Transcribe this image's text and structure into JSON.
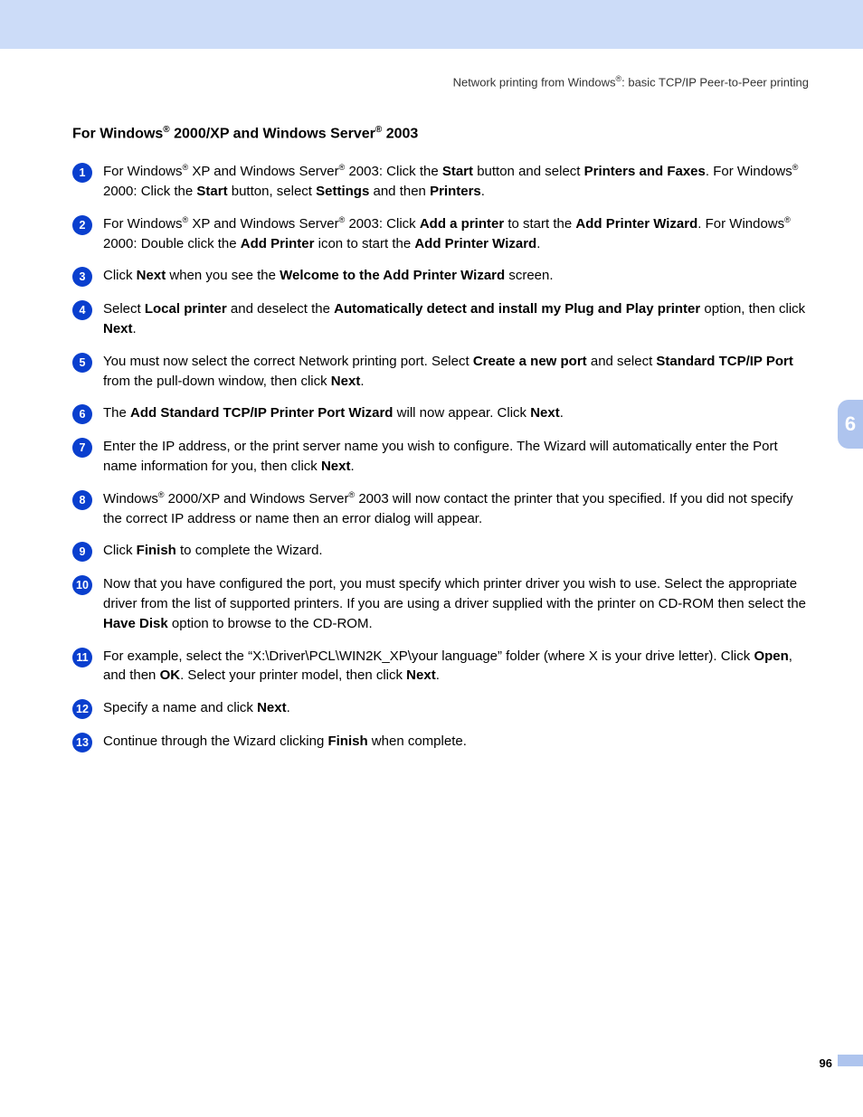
{
  "header": {
    "prefix": "Network printing from Windows",
    "suffix": ": basic TCP/IP Peer-to-Peer printing"
  },
  "heading": {
    "p1": "For Windows",
    "p2": " 2000/XP and Windows Server",
    "p3": " 2003"
  },
  "chapter_tab": "6",
  "page_number": "96",
  "steps": [
    {
      "num": "1",
      "segs": [
        {
          "t": "For Windows"
        },
        {
          "sup": "®"
        },
        {
          "t": " XP and Windows Server"
        },
        {
          "sup": "®"
        },
        {
          "t": " 2003: Click the "
        },
        {
          "b": "Start"
        },
        {
          "t": " button and select "
        },
        {
          "b": "Printers and Faxes"
        },
        {
          "t": ". For Windows"
        },
        {
          "sup": "®"
        },
        {
          "t": " 2000: Click the "
        },
        {
          "b": "Start"
        },
        {
          "t": " button, select "
        },
        {
          "b": "Settings"
        },
        {
          "t": " and then "
        },
        {
          "b": "Printers"
        },
        {
          "t": "."
        }
      ]
    },
    {
      "num": "2",
      "segs": [
        {
          "t": "For Windows"
        },
        {
          "sup": "®"
        },
        {
          "t": " XP and Windows Server"
        },
        {
          "sup": "®"
        },
        {
          "t": " 2003: Click "
        },
        {
          "b": "Add a printer"
        },
        {
          "t": " to start the "
        },
        {
          "b": "Add Printer Wizard"
        },
        {
          "t": ". For Windows"
        },
        {
          "sup": "®"
        },
        {
          "t": " 2000: Double click the "
        },
        {
          "b": "Add Printer"
        },
        {
          "t": " icon to start the "
        },
        {
          "b": "Add Printer Wizard"
        },
        {
          "t": "."
        }
      ]
    },
    {
      "num": "3",
      "segs": [
        {
          "t": "Click "
        },
        {
          "b": "Next"
        },
        {
          "t": " when you see the "
        },
        {
          "b": "Welcome to the Add Printer Wizard"
        },
        {
          "t": " screen."
        }
      ]
    },
    {
      "num": "4",
      "segs": [
        {
          "t": "Select "
        },
        {
          "b": "Local printer"
        },
        {
          "t": " and deselect the "
        },
        {
          "b": "Automatically detect and install my Plug and Play printer"
        },
        {
          "t": " option, then click "
        },
        {
          "b": "Next"
        },
        {
          "t": "."
        }
      ]
    },
    {
      "num": "5",
      "segs": [
        {
          "t": "You must now select the correct Network printing port. Select "
        },
        {
          "b": "Create a new port"
        },
        {
          "t": " and select "
        },
        {
          "b": "Standard TCP/IP Port"
        },
        {
          "t": " from the pull-down window, then click "
        },
        {
          "b": "Next"
        },
        {
          "t": "."
        }
      ]
    },
    {
      "num": "6",
      "segs": [
        {
          "t": "The "
        },
        {
          "b": "Add Standard TCP/IP Printer Port Wizard"
        },
        {
          "t": " will now appear. Click "
        },
        {
          "b": "Next"
        },
        {
          "t": "."
        }
      ]
    },
    {
      "num": "7",
      "segs": [
        {
          "t": "Enter the IP address, or the print server name you wish to configure. The Wizard will automatically enter the Port name information for you, then click "
        },
        {
          "b": "Next"
        },
        {
          "t": "."
        }
      ]
    },
    {
      "num": "8",
      "segs": [
        {
          "t": "Windows"
        },
        {
          "sup": "®"
        },
        {
          "t": " 2000/XP and Windows Server"
        },
        {
          "sup": "®"
        },
        {
          "t": " 2003 will now contact the printer that you specified. If you did not specify the correct IP address or name then an error dialog will appear."
        }
      ]
    },
    {
      "num": "9",
      "segs": [
        {
          "t": "Click "
        },
        {
          "b": "Finish"
        },
        {
          "t": " to complete the Wizard."
        }
      ]
    },
    {
      "num": "10",
      "segs": [
        {
          "t": "Now that you have configured the port, you must specify which printer driver you wish to use. Select the appropriate driver from the list of supported printers. If you are using a driver supplied with the printer on CD-ROM then select the "
        },
        {
          "b": "Have Disk"
        },
        {
          "t": " option to browse to the CD-ROM."
        }
      ]
    },
    {
      "num": "11",
      "segs": [
        {
          "t": "For example, select the “X:\\Driver\\PCL\\WIN2K_XP\\your language” folder (where X is your drive letter). Click "
        },
        {
          "b": "Open"
        },
        {
          "t": ", and then "
        },
        {
          "b": "OK"
        },
        {
          "t": ". Select your printer model, then click "
        },
        {
          "b": "Next"
        },
        {
          "t": "."
        }
      ]
    },
    {
      "num": "12",
      "segs": [
        {
          "t": "Specify a name and click "
        },
        {
          "b": "Next"
        },
        {
          "t": "."
        }
      ]
    },
    {
      "num": "13",
      "segs": [
        {
          "t": "Continue through the Wizard clicking "
        },
        {
          "b": "Finish"
        },
        {
          "t": " when complete."
        }
      ]
    }
  ]
}
